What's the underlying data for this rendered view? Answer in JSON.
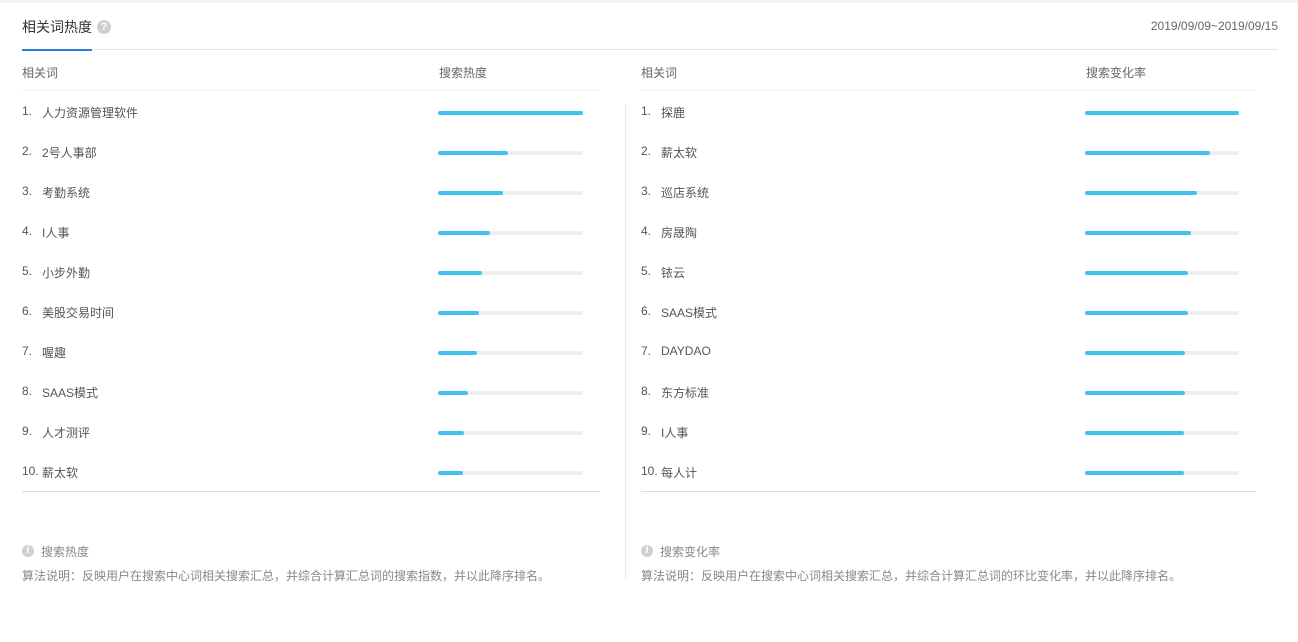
{
  "header": {
    "title": "相关词热度",
    "help_icon": "question-circle-icon",
    "date_range": "2019/09/09~2019/09/15"
  },
  "left_panel": {
    "col_word": "相关词",
    "col_metric": "搜索热度",
    "rows": [
      {
        "rank": "1.",
        "word": "人力资源管理软件",
        "level": 1.0
      },
      {
        "rank": "2.",
        "word": "2号人事部",
        "level": 0.48
      },
      {
        "rank": "3.",
        "word": "考勤系统",
        "level": 0.45
      },
      {
        "rank": "4.",
        "word": "I人事",
        "level": 0.36
      },
      {
        "rank": "5.",
        "word": "小步外勤",
        "level": 0.3
      },
      {
        "rank": "6.",
        "word": "美股交易时间",
        "level": 0.28
      },
      {
        "rank": "7.",
        "word": "喔趣",
        "level": 0.27
      },
      {
        "rank": "8.",
        "word": "SAAS模式",
        "level": 0.21
      },
      {
        "rank": "9.",
        "word": "人才测评",
        "level": 0.18
      },
      {
        "rank": "10.",
        "word": "薪太软",
        "level": 0.17
      }
    ],
    "note_title": "搜索热度",
    "note_text": "算法说明：反映用户在搜索中心词相关搜索汇总，并综合计算汇总词的搜索指数，并以此降序排名。"
  },
  "right_panel": {
    "col_word": "相关词",
    "col_metric": "搜索变化率",
    "rows": [
      {
        "rank": "1.",
        "word": "探鹿",
        "level": 1.0
      },
      {
        "rank": "2.",
        "word": "薪太软",
        "level": 0.81
      },
      {
        "rank": "3.",
        "word": "巡店系统",
        "level": 0.73
      },
      {
        "rank": "4.",
        "word": "房晟陶",
        "level": 0.69
      },
      {
        "rank": "5.",
        "word": "铱云",
        "level": 0.67
      },
      {
        "rank": "6.",
        "word": "SAAS模式",
        "level": 0.67
      },
      {
        "rank": "7.",
        "word": "DAYDAO",
        "level": 0.65
      },
      {
        "rank": "8.",
        "word": "东方标准",
        "level": 0.65
      },
      {
        "rank": "9.",
        "word": "I人事",
        "level": 0.64
      },
      {
        "rank": "10.",
        "word": "每人计",
        "level": 0.64
      }
    ],
    "note_title": "搜索变化率",
    "note_text": "算法说明：反映用户在搜索中心词相关搜索汇总，并综合计算汇总词的环比变化率，并以此降序排名。"
  },
  "colors": {
    "accent": "#2d7ddb",
    "bar_fill": "#3ec3f0",
    "bar_track": "#eeeeee"
  }
}
